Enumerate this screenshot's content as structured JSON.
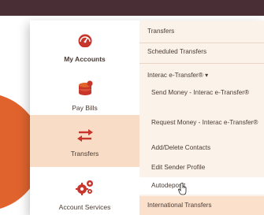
{
  "left_nav": {
    "items": [
      {
        "label": "My Accounts",
        "icon": "speedometer-icon"
      },
      {
        "label": "Pay Bills",
        "icon": "coins-icon"
      },
      {
        "label": "Transfers",
        "icon": "transfer-arrows-icon"
      },
      {
        "label": "Account Services",
        "icon": "gears-icon"
      }
    ],
    "active": "Transfers"
  },
  "submenu": {
    "items": [
      {
        "label": "Transfers"
      },
      {
        "label": "Scheduled Transfers"
      },
      {
        "label": "Interac e-Transfer® ▾"
      },
      {
        "label": "Send Money - Interac e-Transfer®"
      },
      {
        "label": "Request Money - Interac e-Transfer®"
      },
      {
        "label": "Add/Delete Contacts"
      },
      {
        "label": "Edit Sender Profile"
      },
      {
        "label": "Autodeposit"
      },
      {
        "label": "International Transfers"
      }
    ]
  },
  "colors": {
    "brand_red": "#c8352b",
    "brand_orange": "#e0632e",
    "top_bar": "#4a2e35",
    "active_bg": "#f9dcc6"
  }
}
